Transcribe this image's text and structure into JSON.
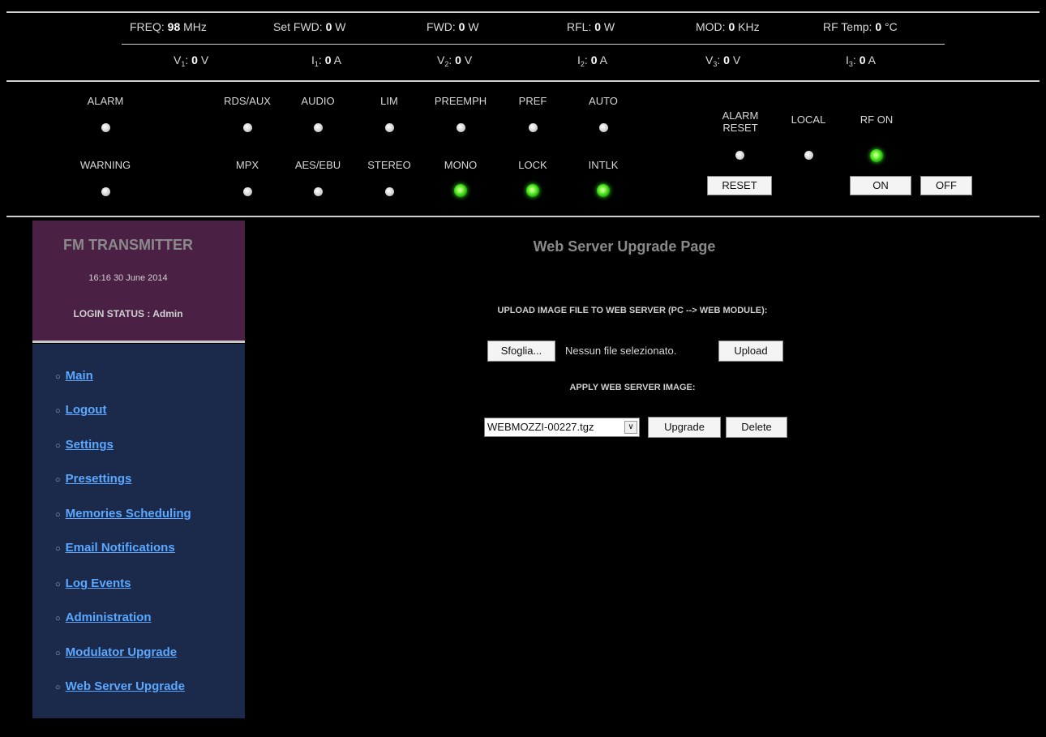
{
  "measurements": {
    "row1": [
      {
        "label": "FREQ: ",
        "value": "98",
        "unit": " MHz"
      },
      {
        "label": "Set FWD: ",
        "value": "0",
        "unit": " W"
      },
      {
        "label": "FWD: ",
        "value": "0",
        "unit": " W"
      },
      {
        "label": "RFL: ",
        "value": "0",
        "unit": " W"
      },
      {
        "label": "MOD: ",
        "value": "0",
        "unit": " KHz"
      },
      {
        "label": "RF Temp: ",
        "value": "0",
        "unit": " °C"
      }
    ],
    "row2": [
      {
        "label": "V",
        "sub": "1",
        "sep": ": ",
        "value": "0",
        "unit": " V"
      },
      {
        "label": "I",
        "sub": "1",
        "sep": ": ",
        "value": "0",
        "unit": " A"
      },
      {
        "label": "V",
        "sub": "2",
        "sep": ": ",
        "value": "0",
        "unit": " V"
      },
      {
        "label": "I",
        "sub": "2",
        "sep": ": ",
        "value": "0",
        "unit": " A"
      },
      {
        "label": "V",
        "sub": "3",
        "sep": ": ",
        "value": "0",
        "unit": " V"
      },
      {
        "label": "I",
        "sub": "3",
        "sep": ": ",
        "value": "0",
        "unit": " A"
      }
    ]
  },
  "indicators": {
    "row1": [
      "ALARM",
      "RDS/AUX",
      "AUDIO",
      "LIM",
      "PREEMPH",
      "PREF",
      "AUTO"
    ],
    "row2": [
      "WARNING",
      "MPX",
      "AES/EBU",
      "STEREO",
      "MONO",
      "LOCK",
      "INTLK"
    ],
    "row2_on": [
      false,
      false,
      false,
      false,
      true,
      true,
      true
    ]
  },
  "controls": {
    "alarm_reset_label_1": "ALARM",
    "alarm_reset_label_2": "RESET",
    "local_label": "LOCAL",
    "rf_on_label": "RF ON",
    "reset_button": "RESET",
    "on_button": "ON",
    "off_button": "OFF"
  },
  "sidebar": {
    "title": "FM TRANSMITTER",
    "datetime": "16:16 30 June 2014",
    "login_status": "LOGIN STATUS : Admin",
    "items": [
      "Main",
      "Logout",
      "Settings",
      "Presettings",
      "Memories Scheduling",
      "Email Notifications",
      "Log Events",
      "Administration",
      "Modulator Upgrade",
      "Web Server Upgrade"
    ]
  },
  "main": {
    "page_title": "Web Server Upgrade Page",
    "upload_heading": "UPLOAD IMAGE FILE TO WEB SERVER (PC --> WEB MODULE):",
    "browse_button": "Sfoglia...",
    "no_file_text": "Nessun file selezionato.",
    "upload_button": "Upload",
    "apply_heading": "APPLY WEB SERVER IMAGE:",
    "image_select_value": "WEBMOZZI-00227.tgz",
    "upgrade_button": "Upgrade",
    "delete_button": "Delete"
  },
  "colors": {
    "background": "#000000",
    "sidebar_header": "#4a2045",
    "sidebar_nav": "#1b2a4a",
    "link": "#5aa8ff",
    "led_on": "#39e61a"
  }
}
